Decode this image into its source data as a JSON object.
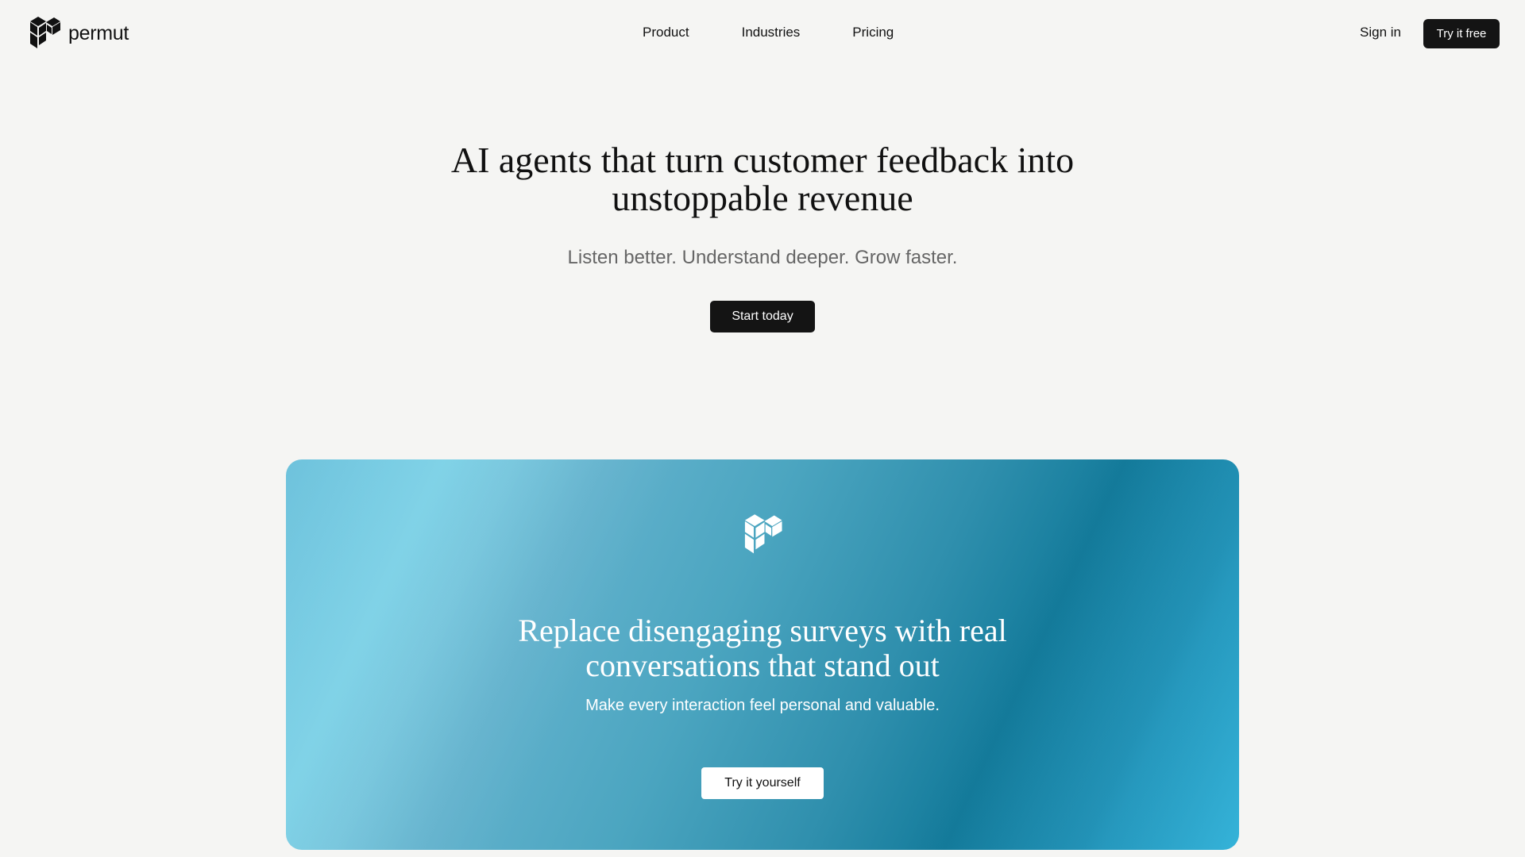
{
  "header": {
    "brand": "permut",
    "nav": [
      {
        "label": "Product"
      },
      {
        "label": "Industries"
      },
      {
        "label": "Pricing"
      }
    ],
    "sign_in_label": "Sign in",
    "try_free_label": "Try it free"
  },
  "hero": {
    "title_line1": "AI agents that turn customer feedback into",
    "title_line2": "unstoppable revenue",
    "subtitle": "Listen better. Understand deeper. Grow faster.",
    "cta_label": "Start today"
  },
  "feature_card": {
    "icon": "permut-logo-icon",
    "title_line1": "Replace disengaging surveys with real",
    "title_line2": "conversations that stand out",
    "subtitle": "Make every interaction feel personal and valuable.",
    "cta_label": "Try it yourself",
    "gradient_colors": [
      "#79d0e6",
      "#4ba5c0",
      "#147c9c",
      "#35b3d9"
    ]
  },
  "colors": {
    "background": "#f5f5f3",
    "button_dark": "#141414",
    "text_primary": "#111111",
    "text_muted": "#666666"
  }
}
